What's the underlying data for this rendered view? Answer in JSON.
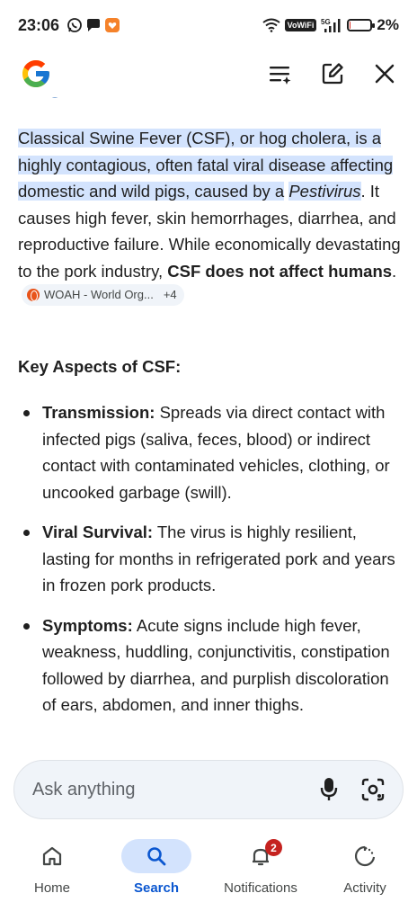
{
  "status_bar": {
    "time": "23:06",
    "vowifi": "VoWiFi",
    "network": "5G",
    "battery_percent": "2%",
    "battery_level": 0.02,
    "left_icons": [
      "whatsapp-icon",
      "chat-bubble-icon",
      "app-notification-icon"
    ],
    "right_icons": [
      "wifi-icon",
      "signal-icon",
      "battery-icon"
    ]
  },
  "header": {
    "logo": "google-g-logo",
    "actions": [
      "history-sparkle-icon",
      "edit-icon",
      "close-icon"
    ]
  },
  "answer": {
    "highlighted_1": "Classical Swine Fever (CSF), or hog cholera, is a highly contagious, often fatal viral disease affecting domestic and wild pigs, caused by a",
    "highlighted_italic": "Pestivirus",
    "text_1": ". It causes high fever, skin hemorrhages, diarrhea, and reproductive failure. While economically devastating to the pork industry, ",
    "bold_1": "CSF does not affect humans",
    "text_2": ".",
    "source_chip": {
      "label": "WOAH - World Org...",
      "count": "+4"
    }
  },
  "section": {
    "title": "Key Aspects of CSF:",
    "bullets": [
      {
        "term": "Transmission:",
        "text": " Spreads via direct contact with infected pigs (saliva, feces, blood) or indirect contact with contaminated vehicles, clothing, or uncooked garbage (swill)."
      },
      {
        "term": "Viral Survival:",
        "text": " The virus is highly resilient, lasting for months in refrigerated pork and years in frozen pork products."
      },
      {
        "term": "Symptoms:",
        "text": " Acute signs include high fever, weakness, huddling, conjunctivitis, constipation followed by diarrhea, and purplish discoloration of ears, abdomen, and inner thighs."
      }
    ]
  },
  "ask_bar": {
    "placeholder": "Ask anything",
    "icons": [
      "microphone-icon",
      "lens-camera-icon"
    ]
  },
  "bottom_nav": {
    "items": [
      {
        "label": "Home",
        "icon": "home-icon"
      },
      {
        "label": "Search",
        "icon": "search-icon",
        "active": true
      },
      {
        "label": "Notifications",
        "icon": "bell-icon",
        "badge": "2"
      },
      {
        "label": "Activity",
        "icon": "activity-icon"
      }
    ]
  },
  "colors": {
    "highlight": "#d3e3fd",
    "accent": "#0b57d0",
    "badge": "#c5221f",
    "text": "#1f1f1f"
  }
}
